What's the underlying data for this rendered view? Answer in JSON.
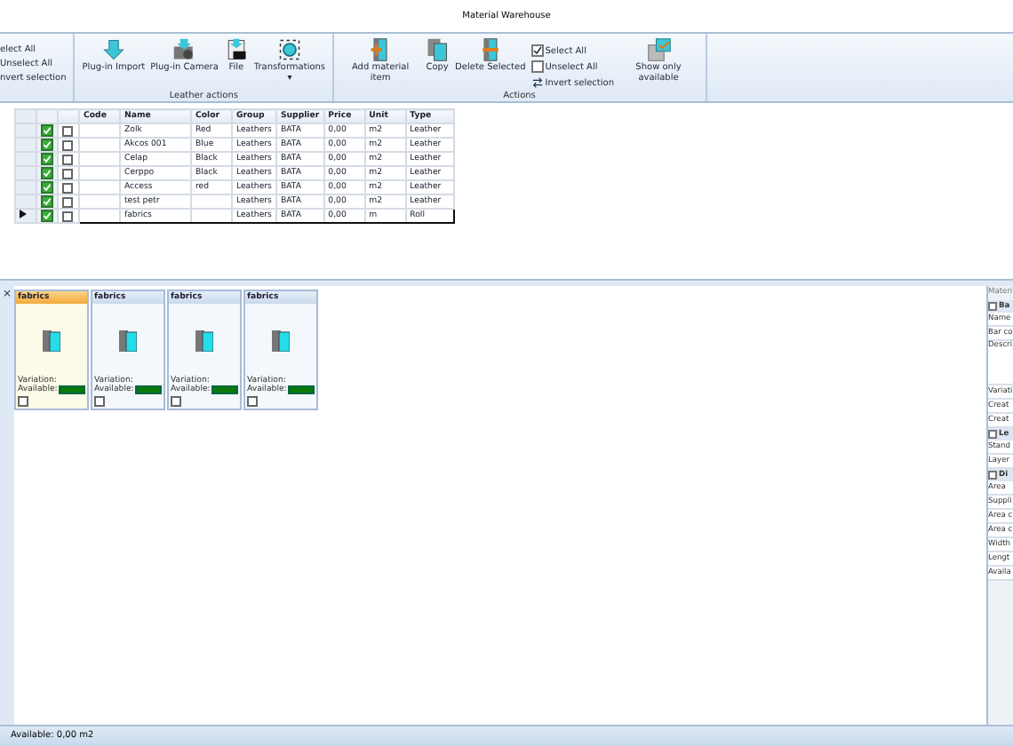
{
  "window": {
    "title": "Material Warehouse"
  },
  "ribbon": {
    "groups": [
      {
        "items": [
          {
            "kind": "small",
            "label": "elect All"
          },
          {
            "kind": "small",
            "label": "Unselect All"
          },
          {
            "kind": "small",
            "label": "nvert selection"
          }
        ]
      },
      {
        "label": "Leather actions",
        "items": [
          {
            "kind": "large",
            "label": "Plug-in Import"
          },
          {
            "kind": "large",
            "label": "Plug-in Camera"
          },
          {
            "kind": "large",
            "label": "File"
          },
          {
            "kind": "large",
            "label": "Transformations",
            "caret": "▾"
          }
        ]
      },
      {
        "label": "Actions",
        "items": [
          {
            "kind": "large",
            "label": "Add material item"
          },
          {
            "kind": "large",
            "label": "Copy"
          },
          {
            "kind": "large",
            "label": "Delete Selected"
          },
          {
            "kind": "check",
            "checked": true,
            "label": "Select All"
          },
          {
            "kind": "check",
            "checked": false,
            "label": "Unselect All"
          },
          {
            "kind": "small",
            "label": "Invert selection"
          },
          {
            "kind": "large",
            "label": "Show only available"
          }
        ]
      }
    ]
  },
  "table": {
    "columns": [
      "Code",
      "Name",
      "Color",
      "Group",
      "Supplier",
      "Price",
      "Unit",
      "Type"
    ],
    "rows": [
      {
        "selected": false,
        "active": true,
        "checked": false,
        "cells": [
          "",
          "Zolk",
          "Red",
          "Leathers",
          "BATA",
          "0,00",
          "m2",
          "Leather"
        ]
      },
      {
        "selected": false,
        "active": true,
        "checked": false,
        "cells": [
          "",
          "Akcos 001",
          "Blue",
          "Leathers",
          "BATA",
          "0,00",
          "m2",
          "Leather"
        ]
      },
      {
        "selected": false,
        "active": true,
        "checked": false,
        "cells": [
          "",
          "Celap",
          "Black",
          "Leathers",
          "BATA",
          "0,00",
          "m2",
          "Leather"
        ]
      },
      {
        "selected": false,
        "active": true,
        "checked": false,
        "cells": [
          "",
          "Cerppo",
          "Black",
          "Leathers",
          "BATA",
          "0,00",
          "m2",
          "Leather"
        ]
      },
      {
        "selected": false,
        "active": true,
        "checked": false,
        "cells": [
          "",
          "Access",
          "red",
          "Leathers",
          "BATA",
          "0,00",
          "m2",
          "Leather"
        ]
      },
      {
        "selected": false,
        "active": true,
        "checked": false,
        "cells": [
          "",
          "test petr",
          "",
          "Leathers",
          "BATA",
          "0,00",
          "m2",
          "Leather"
        ]
      },
      {
        "selected": true,
        "active": true,
        "checked": false,
        "cells": [
          "",
          "fabrics",
          "",
          "Leathers",
          "BATA",
          "0,00",
          "m",
          "Roll"
        ]
      }
    ]
  },
  "close_button": "×",
  "cards": [
    {
      "title": "fabrics",
      "selected": true,
      "variation": "Variation:",
      "available": "Available:",
      "checked": false
    },
    {
      "title": "fabrics",
      "selected": false,
      "variation": "Variation:",
      "available": "Available:",
      "checked": false
    },
    {
      "title": "fabrics",
      "selected": false,
      "variation": "Variation:",
      "available": "Available:",
      "checked": false
    },
    {
      "title": "fabrics",
      "selected": false,
      "variation": "Variation:",
      "available": "Available:",
      "checked": false
    }
  ],
  "properties": {
    "title": "Materi",
    "items": [
      {
        "kind": "section",
        "label": "Ba"
      },
      {
        "kind": "row",
        "label": "Name"
      },
      {
        "kind": "row",
        "label": "Bar co"
      },
      {
        "kind": "tall",
        "label": "Descri"
      },
      {
        "kind": "row",
        "label": "Variati"
      },
      {
        "kind": "row",
        "label": "Creat"
      },
      {
        "kind": "row",
        "label": "Creat"
      },
      {
        "kind": "section",
        "label": "Le"
      },
      {
        "kind": "row",
        "label": "Stand"
      },
      {
        "kind": "row",
        "label": "Layer"
      },
      {
        "kind": "section",
        "label": "Di"
      },
      {
        "kind": "row",
        "label": "Area"
      },
      {
        "kind": "row",
        "label": "Suppli"
      },
      {
        "kind": "row",
        "label": "Area c"
      },
      {
        "kind": "row",
        "label": "Area c"
      },
      {
        "kind": "row",
        "label": "Width"
      },
      {
        "kind": "row",
        "label": "Lengt"
      },
      {
        "kind": "row",
        "label": "Availa"
      }
    ]
  },
  "status_bar": {
    "text": "Available: 0,00 m2"
  }
}
